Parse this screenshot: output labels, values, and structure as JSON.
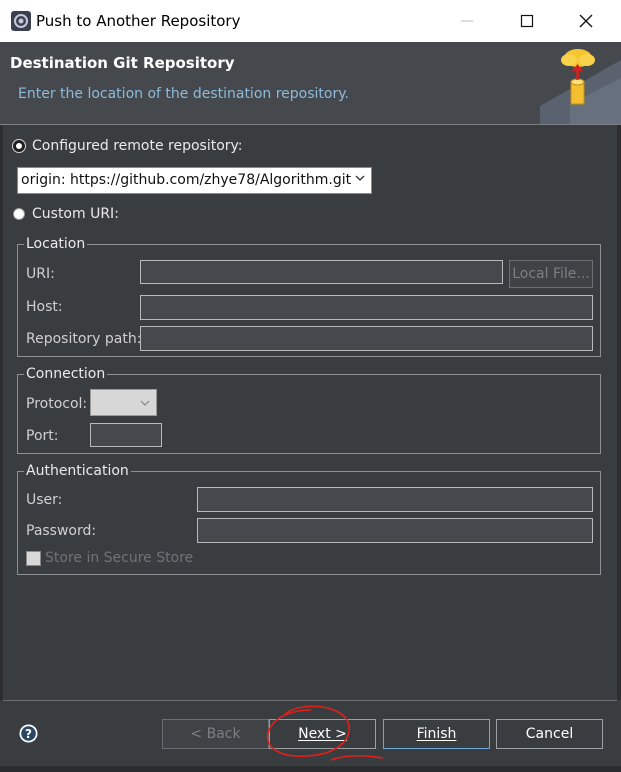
{
  "window": {
    "title": "Push to Another Repository",
    "icon": "eclipse-gear-icon"
  },
  "header": {
    "title": "Destination Git Repository",
    "description": "Enter the location of the destination repository.",
    "icon": "cloud-upload-repository-icon"
  },
  "configured_remote": {
    "label": "Configured remote repository:",
    "selected": true,
    "select_value": "origin: https://github.com/zhye78/Algorithm.git"
  },
  "custom_uri": {
    "label": "Custom URI:",
    "selected": false
  },
  "location": {
    "title": "Location",
    "uri_label": "URI:",
    "uri_value": "",
    "local_file_button": "Local File...",
    "host_label": "Host:",
    "host_value": "",
    "repo_path_label": "Repository path:",
    "repo_path_value": ""
  },
  "connection": {
    "title": "Connection",
    "protocol_label": "Protocol:",
    "protocol_value": "",
    "port_label": "Port:",
    "port_value": ""
  },
  "authentication": {
    "title": "Authentication",
    "user_label": "User:",
    "user_value": "",
    "password_label": "Password:",
    "password_value": "",
    "store_label": "Store in Secure Store",
    "store_checked": false
  },
  "footer": {
    "help_icon": "help-icon",
    "back_label": "< Back",
    "next_label": "Next >",
    "finish_label": "Finish",
    "cancel_label": "Cancel"
  },
  "colors": {
    "background": "#3a3d40",
    "header_background": "#45494d",
    "description_text": "#8ebbd9",
    "annotation_red": "#e0201a"
  }
}
